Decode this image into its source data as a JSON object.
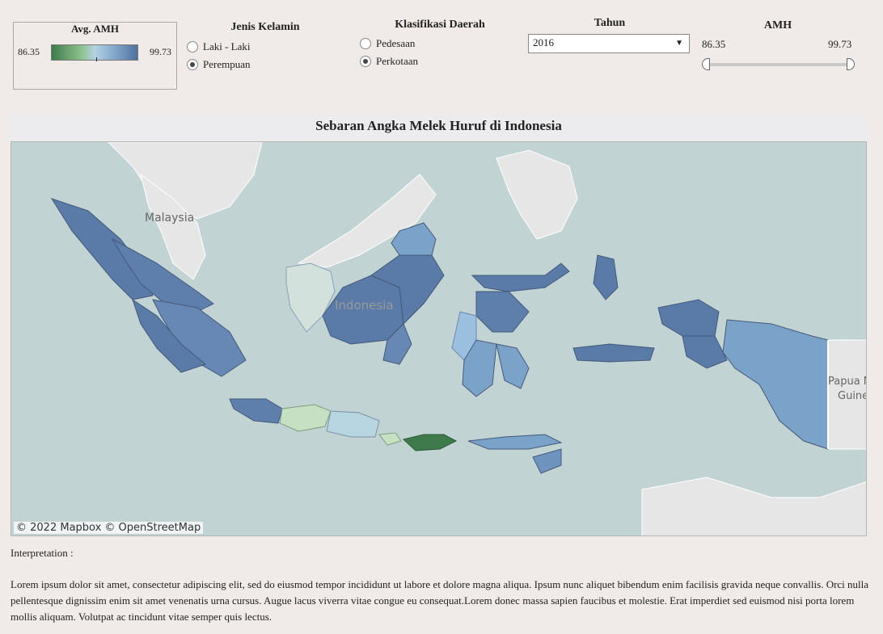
{
  "legend": {
    "title": "Avg. AMH",
    "min": "86.35",
    "max": "99.73",
    "color_low": "#3e7a4c",
    "color_mid": "#b3d2e3",
    "color_high": "#4f71a0"
  },
  "gender_filter": {
    "title": "Jenis Kelamin",
    "options": [
      "Laki - Laki",
      "Perempuan"
    ],
    "selected": "Perempuan"
  },
  "region_filter": {
    "title": "Klasifikasi Daerah",
    "options": [
      "Pedesaan",
      "Perkotaan"
    ],
    "selected": "Perkotaan"
  },
  "year_filter": {
    "title": "Tahun",
    "value": "2016"
  },
  "amh_slider": {
    "title": "AMH",
    "min": "86.35",
    "max": "99.73"
  },
  "map": {
    "title": "Sebaran Angka Melek Huruf di Indonesia",
    "labels": {
      "malaysia": "Malaysia",
      "indonesia": "Indonesia",
      "papua_line1": "Papua N",
      "papua_line2": "Guine"
    },
    "attribution": "© 2022 Mapbox  © OpenStreetMap"
  },
  "interpretation": {
    "label": "Interpretation :",
    "text": "Lorem ipsum dolor sit amet, consectetur adipiscing elit, sed do eiusmod tempor incididunt ut labore et dolore magna aliqua. Ipsum nunc aliquet bibendum enim facilisis gravida neque convallis. Orci nulla pellentesque dignissim enim sit amet venenatis urna cursus. Augue lacus viverra vitae congue eu consequat.Lorem donec massa sapien faucibus et molestie. Erat imperdiet sed euismod nisi porta lorem mollis aliquam. Volutpat ac tincidunt vitae semper quis lectus."
  }
}
